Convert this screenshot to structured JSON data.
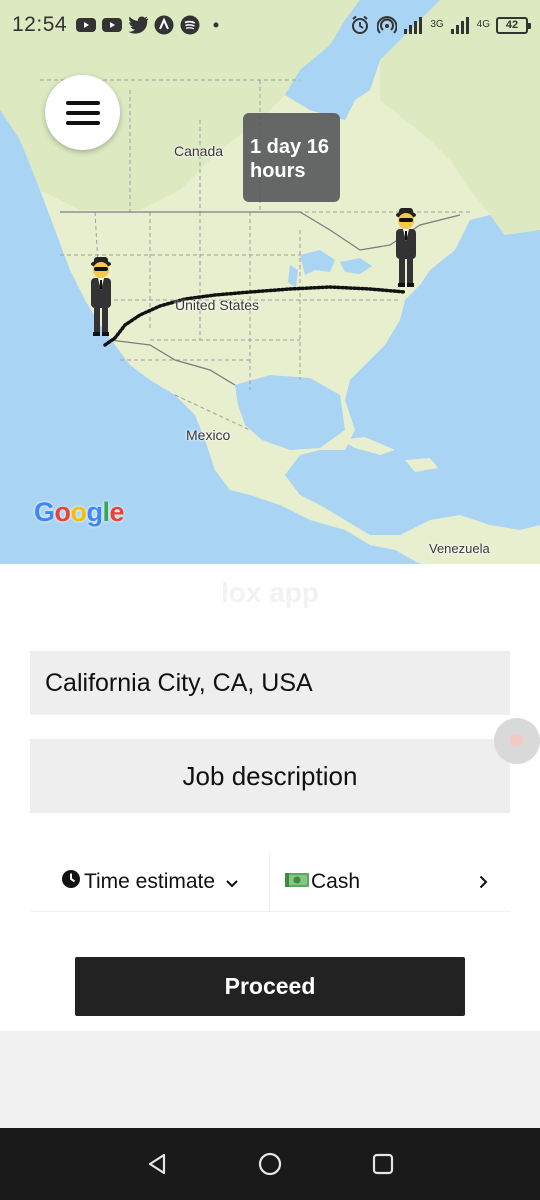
{
  "status_bar": {
    "time": "12:54",
    "left_icons": [
      "youtube-icon",
      "youtube-icon",
      "twitter-icon",
      "app-a-icon",
      "spotify-icon",
      "dot-icon"
    ],
    "right_icons": [
      "alarm-icon",
      "hotspot-icon",
      "signal-icon",
      "signal-icon"
    ],
    "net_labels": [
      "3G",
      "4G"
    ],
    "battery": "42"
  },
  "map": {
    "eta": "1 day 16 hours",
    "labels": {
      "canada": "Canada",
      "united_states": "United States",
      "mexico": "Mexico",
      "venezuela": "Venezuela"
    },
    "google_logo": [
      "G",
      "o",
      "o",
      "g",
      "l",
      "e"
    ],
    "google_colors": [
      "#4285F4",
      "#EA4335",
      "#FBBC05",
      "#4285F4",
      "#34A853",
      "#EA4335"
    ],
    "water_color": "#a9d4f4",
    "land_color": "#e8efcf"
  },
  "app": {
    "title": "lox app"
  },
  "form": {
    "location": "California City, CA, USA",
    "job_description": "Job description",
    "time_estimate": "Time estimate",
    "payment": "Cash",
    "proceed": "Proceed"
  }
}
